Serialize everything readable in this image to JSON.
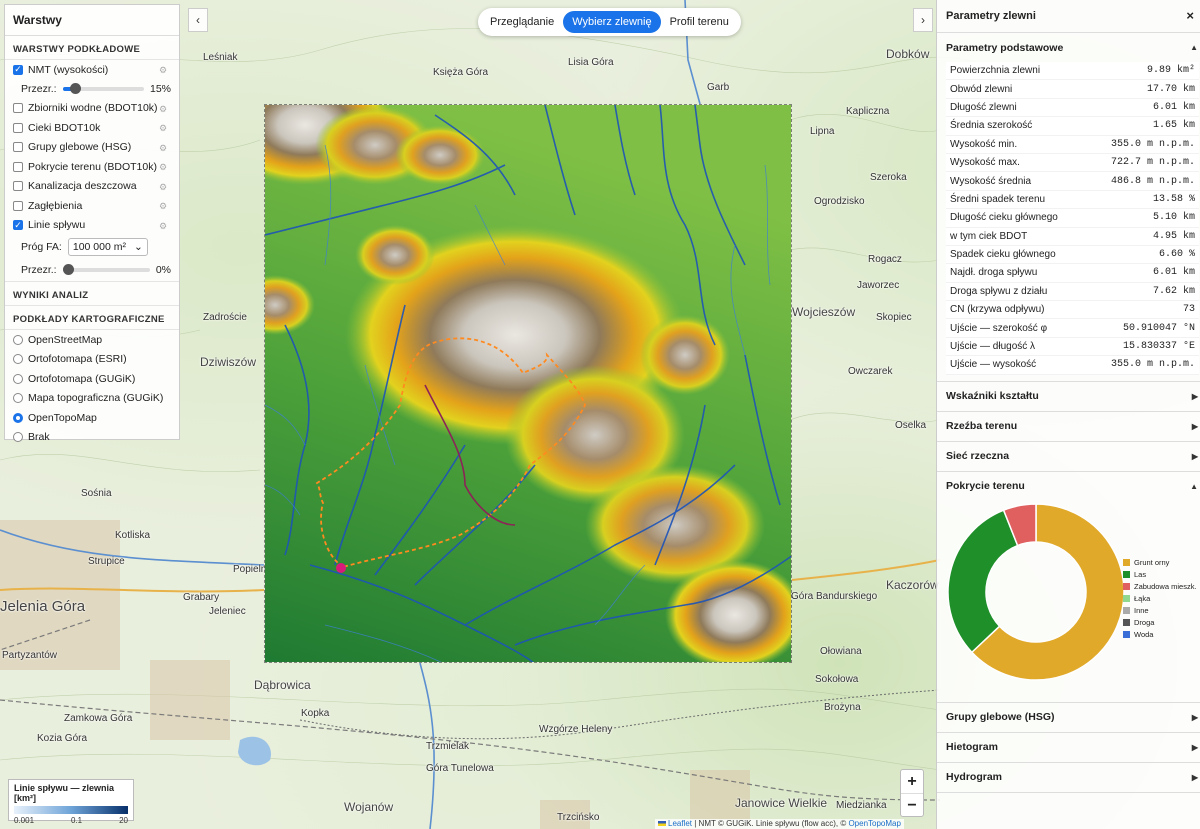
{
  "map": {
    "labels": [
      "Leśniak",
      "Księża Góra",
      "Lisia Góra",
      "Dobków",
      "Garb",
      "Kapliczna",
      "Lipna",
      "Szeroka",
      "Ogrodzisko",
      "Jaworzec",
      "Dziwiszów",
      "Zadroście",
      "Wojcieszów",
      "Owczarek",
      "Oselka",
      "Sośnia",
      "Kotliska",
      "Strupice",
      "Jelenia Góra",
      "Popielnik",
      "Grabary",
      "Jeleniec",
      "Partyzantów",
      "Góra Bandurskiego",
      "Kaczorów",
      "Dąbrowica",
      "Kopka",
      "Zamkowa Góra",
      "Kozia Góra",
      "Wzgórze Heleny",
      "Trzmielak",
      "Góra Tunelowa",
      "Sokołowa",
      "Brożyna",
      "Janowice Wielkie",
      "Miedzianka",
      "Trzcińsko",
      "Wojanów",
      "Ołowiana",
      "Skopiec",
      "Rogacz"
    ],
    "flow_legend": {
      "title": "Linie spływu — zlewnia [km²]",
      "ticks": [
        "0.001",
        "0.1",
        "20"
      ]
    },
    "zoom_in": "+",
    "zoom_out": "−",
    "attribution": {
      "leaflet": "Leaflet",
      "text": " | NMT © GUGiK. Linie spływu (flow acc), © ",
      "otm": "OpenTopoMap"
    }
  },
  "layers": {
    "title": "Warstwy",
    "base_section": "WARSTWY PODKŁADOWE",
    "items": [
      {
        "label": "NMT (wysokości)",
        "checked": true
      },
      {
        "label": "Zbiorniki wodne (BDOT10k)",
        "checked": false
      },
      {
        "label": "Cieki BDOT10k",
        "checked": false
      },
      {
        "label": "Grupy glebowe (HSG)",
        "checked": false
      },
      {
        "label": "Pokrycie terenu (BDOT10k)",
        "checked": false
      },
      {
        "label": "Kanalizacja deszczowa",
        "checked": false
      },
      {
        "label": "Zagłębienia",
        "checked": false
      },
      {
        "label": "Linie spływu",
        "checked": true
      }
    ],
    "nmt_opacity_label": "Przezr.:",
    "nmt_opacity": 15,
    "nmt_opacity_text": "15%",
    "fa_label": "Próg FA:",
    "fa_value": "100 000 m²",
    "flow_opacity_label": "Przezr.:",
    "flow_opacity": 0,
    "flow_opacity_text": "0%",
    "results_section": "WYNIKI ANALIZ",
    "carto_section": "PODKŁADY KARTOGRAFICZNE",
    "basemaps": [
      {
        "label": "OpenStreetMap",
        "selected": false
      },
      {
        "label": "Ortofotomapa (ESRI)",
        "selected": false
      },
      {
        "label": "Ortofotomapa (GUGiK)",
        "selected": false
      },
      {
        "label": "Mapa topograficzna (GUGiK)",
        "selected": false
      },
      {
        "label": "OpenTopoMap",
        "selected": true
      },
      {
        "label": "Brak",
        "selected": false
      }
    ],
    "collapse": "‹"
  },
  "modes": {
    "items": [
      "Przeglądanie",
      "Wybierz zlewnię",
      "Profil terenu"
    ],
    "active": 1
  },
  "right_collapse": "›",
  "params": {
    "title": "Parametry zlewni",
    "close": "×",
    "basic_section": "Parametry podstawowe",
    "rows": [
      {
        "label": "Powierzchnia zlewni",
        "value": "9.89 km²"
      },
      {
        "label": "Obwód zlewni",
        "value": "17.70 km"
      },
      {
        "label": "Długość zlewni",
        "value": "6.01 km"
      },
      {
        "label": "Średnia szerokość",
        "value": "1.65 km"
      },
      {
        "label": "Wysokość min.",
        "value": "355.0 m n.p.m."
      },
      {
        "label": "Wysokość max.",
        "value": "722.7 m n.p.m."
      },
      {
        "label": "Wysokość średnia",
        "value": "486.8 m n.p.m."
      },
      {
        "label": "Średni spadek terenu",
        "value": "13.58 %"
      },
      {
        "label": "Długość cieku głównego",
        "value": "5.10 km"
      },
      {
        "label": "w tym ciek BDOT",
        "value": "4.95 km"
      },
      {
        "label": "Spadek cieku głównego",
        "value": "6.60 %"
      },
      {
        "label": "Najdł. droga spływu",
        "value": "6.01 km"
      },
      {
        "label": "Droga spływu z działu",
        "value": "7.62 km"
      },
      {
        "label": "CN (krzywa odpływu)",
        "value": "73"
      },
      {
        "label": "Ujście — szerokość φ",
        "value": "50.910047 °N"
      },
      {
        "label": "Ujście — długość λ",
        "value": "15.830337 °E"
      },
      {
        "label": "Ujście — wysokość",
        "value": "355.0 m n.p.m."
      }
    ],
    "sections_before": [
      "Wskaźniki kształtu",
      "Rzeźba terenu",
      "Sieć rzeczna"
    ],
    "landcover_section": "Pokrycie terenu",
    "sections_after": [
      "Grupy glebowe (HSG)",
      "Hietogram",
      "Hydrogram"
    ]
  },
  "chart_data": {
    "type": "pie",
    "variant": "donut",
    "legend_position": "right",
    "categories": [
      "Grunt orny",
      "Las",
      "Zabudowa mieszk.",
      "Łąka",
      "Inne",
      "Droga",
      "Woda"
    ],
    "values": [
      63,
      31,
      6,
      0,
      0,
      0,
      0
    ],
    "colors": [
      "#e0a92a",
      "#1f8f2a",
      "#e06060",
      "#90d890",
      "#aaaaaa",
      "#555555",
      "#3a6fd8"
    ]
  }
}
